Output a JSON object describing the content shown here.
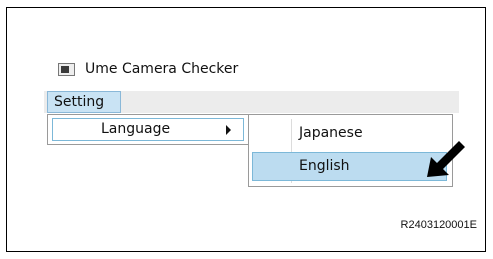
{
  "window": {
    "title": "Ume Camera Checker",
    "icon": "app-window-icon"
  },
  "menubar": {
    "items": [
      {
        "label": "Setting"
      }
    ]
  },
  "setting_menu": {
    "items": [
      {
        "label": "Language",
        "has_submenu": true,
        "submenu_icon": "chevron-right-icon"
      }
    ]
  },
  "language_menu": {
    "items": [
      {
        "label": "Japanese",
        "highlighted": false
      },
      {
        "label": "English",
        "highlighted": true
      }
    ]
  },
  "annotation": {
    "pointer_icon": "black-arrow-pointer-icon",
    "reference_code": "R2403120001E"
  },
  "colors": {
    "highlight_fill": "#bcdcf0",
    "highlight_border": "#7cb8d8",
    "menubar_bg": "#ececec"
  }
}
